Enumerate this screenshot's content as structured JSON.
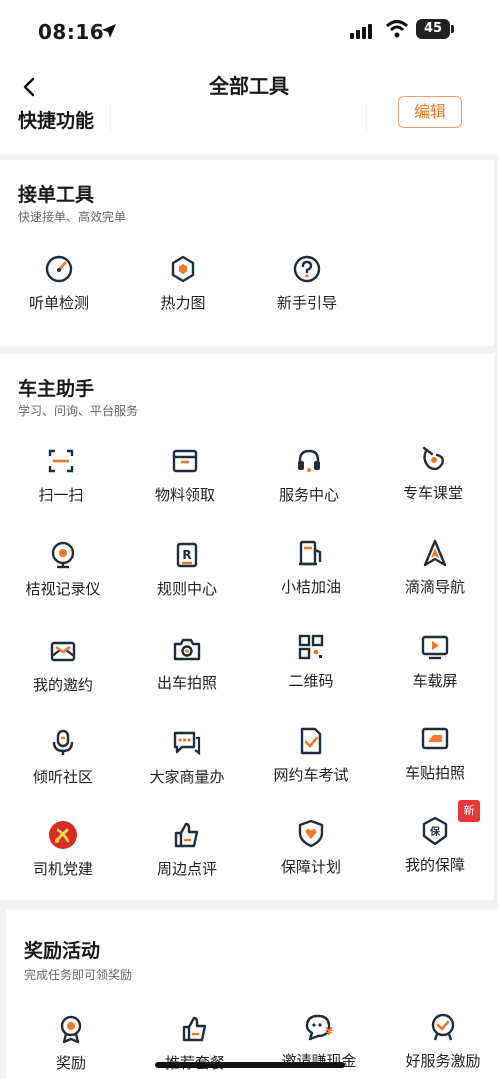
{
  "status": {
    "time": "08:16",
    "battery": "45"
  },
  "header": {
    "title": "全部工具",
    "quick_label": "快捷功能",
    "edit_label": "编辑"
  },
  "sections": [
    {
      "title": "接单工具",
      "subtitle": "快速接单、高效完单",
      "items": [
        {
          "label": "听单检测",
          "icon": "gauge-icon"
        },
        {
          "label": "热力图",
          "icon": "hexagon-icon"
        },
        {
          "label": "新手引导",
          "icon": "question-icon"
        }
      ]
    },
    {
      "title": "车主助手",
      "subtitle": "学习、问询、平台服务",
      "items": [
        {
          "label": "扫一扫",
          "icon": "scan-icon"
        },
        {
          "label": "物料领取",
          "icon": "package-icon"
        },
        {
          "label": "服务中心",
          "icon": "headset-icon"
        },
        {
          "label": "专车课堂",
          "icon": "class-icon"
        },
        {
          "label": "桔视记录仪",
          "icon": "camera-recorder-icon"
        },
        {
          "label": "规则中心",
          "icon": "rules-icon"
        },
        {
          "label": "小桔加油",
          "icon": "fuel-icon"
        },
        {
          "label": "滴滴导航",
          "icon": "navigation-icon"
        },
        {
          "label": "我的邀约",
          "icon": "mail-icon"
        },
        {
          "label": "出车拍照",
          "icon": "photo-icon"
        },
        {
          "label": "二维码",
          "icon": "qrcode-icon"
        },
        {
          "label": "车载屏",
          "icon": "screen-icon"
        },
        {
          "label": "倾听社区",
          "icon": "microphone-icon"
        },
        {
          "label": "大家商量办",
          "icon": "chat-icon"
        },
        {
          "label": "网约车考试",
          "icon": "exam-icon"
        },
        {
          "label": "车贴拍照",
          "icon": "sticker-icon"
        },
        {
          "label": "司机党建",
          "icon": "party-emblem-icon"
        },
        {
          "label": "周边点评",
          "icon": "thumbs-up-icon"
        },
        {
          "label": "保障计划",
          "icon": "heart-shield-icon"
        },
        {
          "label": "我的保障",
          "icon": "insurance-icon",
          "badge": "新"
        }
      ]
    },
    {
      "title": "奖励活动",
      "subtitle": "完成任务即可领奖励",
      "items": [
        {
          "label": "奖励",
          "icon": "medal-icon"
        },
        {
          "label": "推荐套餐",
          "icon": "thumbs-up-icon"
        },
        {
          "label": "邀请赚现金",
          "icon": "cash-chat-icon"
        },
        {
          "label": "好服务激励",
          "icon": "badge-check-icon"
        }
      ]
    }
  ],
  "colors": {
    "accent": "#f07828",
    "icon": "#1f2d3d",
    "party_red": "#d82c20",
    "badge_red": "#e53935"
  }
}
